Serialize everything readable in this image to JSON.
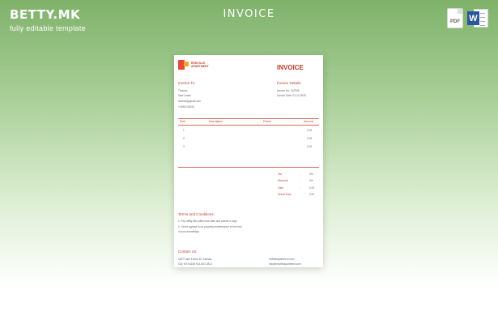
{
  "brand": {
    "logo": "BETTY.MK",
    "tagline": "fully editable template"
  },
  "page": {
    "title": "INVOICE"
  },
  "file_icons": [
    {
      "icon": "pdf-file-icon",
      "label": "PDF"
    },
    {
      "icon": "word-file-icon",
      "label": "W"
    }
  ],
  "invoice": {
    "company": "REDVILLE APARTMENT",
    "title": "INVOICE",
    "invoice_to": {
      "heading": "Invoice To:",
      "name": "Thomas",
      "role": "Sale Lease",
      "email": "thomas@gmail.com",
      "phone": "+4190122635"
    },
    "details": {
      "heading": "Invoice Details:",
      "number": "Invoice No: 012345",
      "date": "Invoice Date: 01-12-2025"
    },
    "columns": [
      "Sold",
      "Description",
      "Period",
      "Amount"
    ],
    "rows": [
      {
        "no": "1",
        "amount": "0.00"
      },
      {
        "no": "2",
        "amount": "0.00"
      },
      {
        "no": "3",
        "amount": "0.00"
      }
    ],
    "summary": [
      {
        "label": "Tax",
        "value": "0%"
      },
      {
        "label": "Discount",
        "value": "0%"
      },
      {
        "label": "Total",
        "value": "0.00"
      },
      {
        "label": "Grand Total",
        "value": "0.00"
      }
    ],
    "terms": {
      "heading": "Terms and Conditions:",
      "line1": "1. Pay utility bills within due date and submit a copy",
      "line2": "2. You're agreed to do property maintenance to the best",
      "line3": "of your knowledge"
    },
    "contact": {
      "heading": "Contact Us:",
      "address1": "1837 Lake Forest Dr, Kansas",
      "address2": "City, KS 64108 913-837-2813",
      "web": "redvilleapartment.com",
      "email": "info@redvilleapartment.com"
    }
  }
}
